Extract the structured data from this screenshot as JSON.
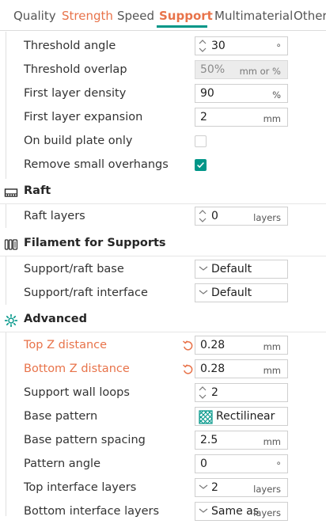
{
  "tabs": [
    {
      "label": "Quality",
      "state": "normal"
    },
    {
      "label": "Strength",
      "state": "modified"
    },
    {
      "label": "Speed",
      "state": "normal"
    },
    {
      "label": "Support",
      "state": "active"
    },
    {
      "label": "Multimaterial",
      "state": "normal"
    },
    {
      "label": "Others",
      "state": "normal"
    }
  ],
  "colors": {
    "accent": "#009688",
    "modified": "#e8734a"
  },
  "support": {
    "threshold_angle": {
      "label": "Threshold angle",
      "value": "30",
      "unit": "°"
    },
    "threshold_overlap": {
      "label": "Threshold overlap",
      "value": "50%",
      "unit": "mm or %"
    },
    "first_layer_density": {
      "label": "First layer density",
      "value": "90",
      "unit": "%"
    },
    "first_layer_expansion": {
      "label": "First layer expansion",
      "value": "2",
      "unit": "mm"
    },
    "on_build_plate_only": {
      "label": "On build plate only",
      "checked": false
    },
    "remove_small_overhangs": {
      "label": "Remove small overhangs",
      "checked": true
    }
  },
  "raft": {
    "title": "Raft",
    "icon": "raft-icon",
    "raft_layers": {
      "label": "Raft layers",
      "value": "0",
      "unit": "layers"
    }
  },
  "filament": {
    "title": "Filament for Supports",
    "icon": "filament-icon",
    "base": {
      "label": "Support/raft base",
      "value": "Default"
    },
    "interface": {
      "label": "Support/raft interface",
      "value": "Default"
    }
  },
  "advanced": {
    "title": "Advanced",
    "icon": "advanced-gear-icon",
    "top_z": {
      "label": "Top Z distance",
      "value": "0.28",
      "unit": "mm"
    },
    "bottom_z": {
      "label": "Bottom Z distance",
      "value": "0.28",
      "unit": "mm"
    },
    "wall_loops": {
      "label": "Support wall loops",
      "value": "2"
    },
    "base_pattern": {
      "label": "Base pattern",
      "value": "Rectilinear"
    },
    "base_pattern_spacing": {
      "label": "Base pattern spacing",
      "value": "2.5",
      "unit": "mm"
    },
    "pattern_angle": {
      "label": "Pattern angle",
      "value": "0",
      "unit": "°"
    },
    "top_interface_layers": {
      "label": "Top interface layers",
      "value": "2",
      "unit": "layers"
    },
    "bottom_interface_layers": {
      "label": "Bottom interface layers",
      "value": "Same as",
      "unit": "layers"
    }
  }
}
